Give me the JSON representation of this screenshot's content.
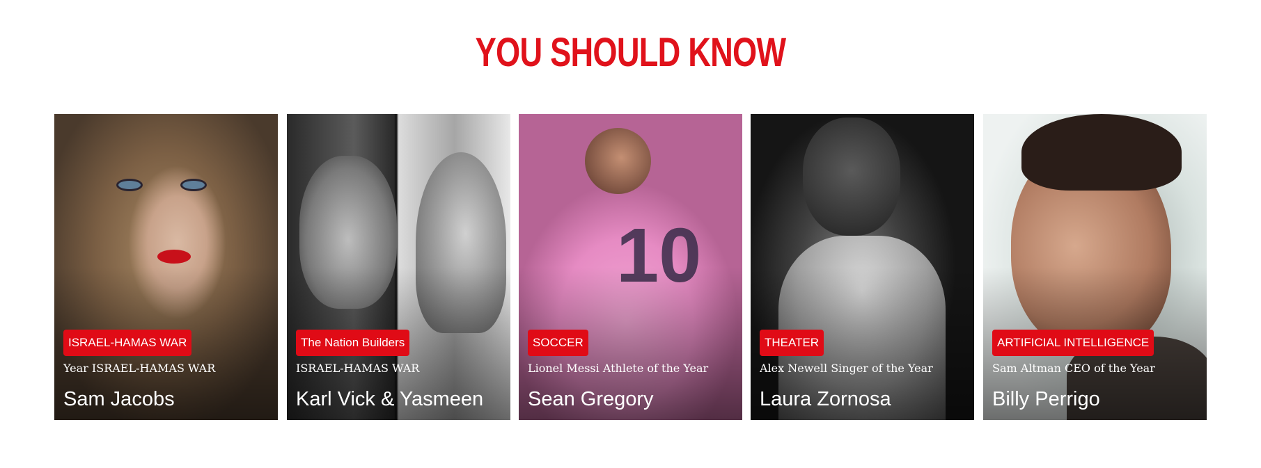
{
  "section": {
    "title": "YOU SHOULD KNOW"
  },
  "cards": [
    {
      "tag": "ISRAEL-HAMAS WAR",
      "subtitle": "Year ISRAEL-HAMAS WAR",
      "author": "Sam Jacobs"
    },
    {
      "tag": "The Nation Builders",
      "subtitle": "ISRAEL-HAMAS WAR",
      "author": "Karl Vick & Yasmeen"
    },
    {
      "tag": "SOCCER",
      "subtitle": "Lionel Messi Athlete of the Year",
      "author": "Sean Gregory"
    },
    {
      "tag": "THEATER",
      "subtitle": "Alex Newell Singer of the Year",
      "author": "Laura Zornosa"
    },
    {
      "tag": "ARTIFICIAL INTELLIGENCE",
      "subtitle": "Sam Altman CEO of the Year",
      "author": "Billy Perrigo"
    }
  ],
  "colors": {
    "accent": "#e0121b",
    "tag_bg": "#e00b16",
    "text_on_image": "#ffffff"
  }
}
